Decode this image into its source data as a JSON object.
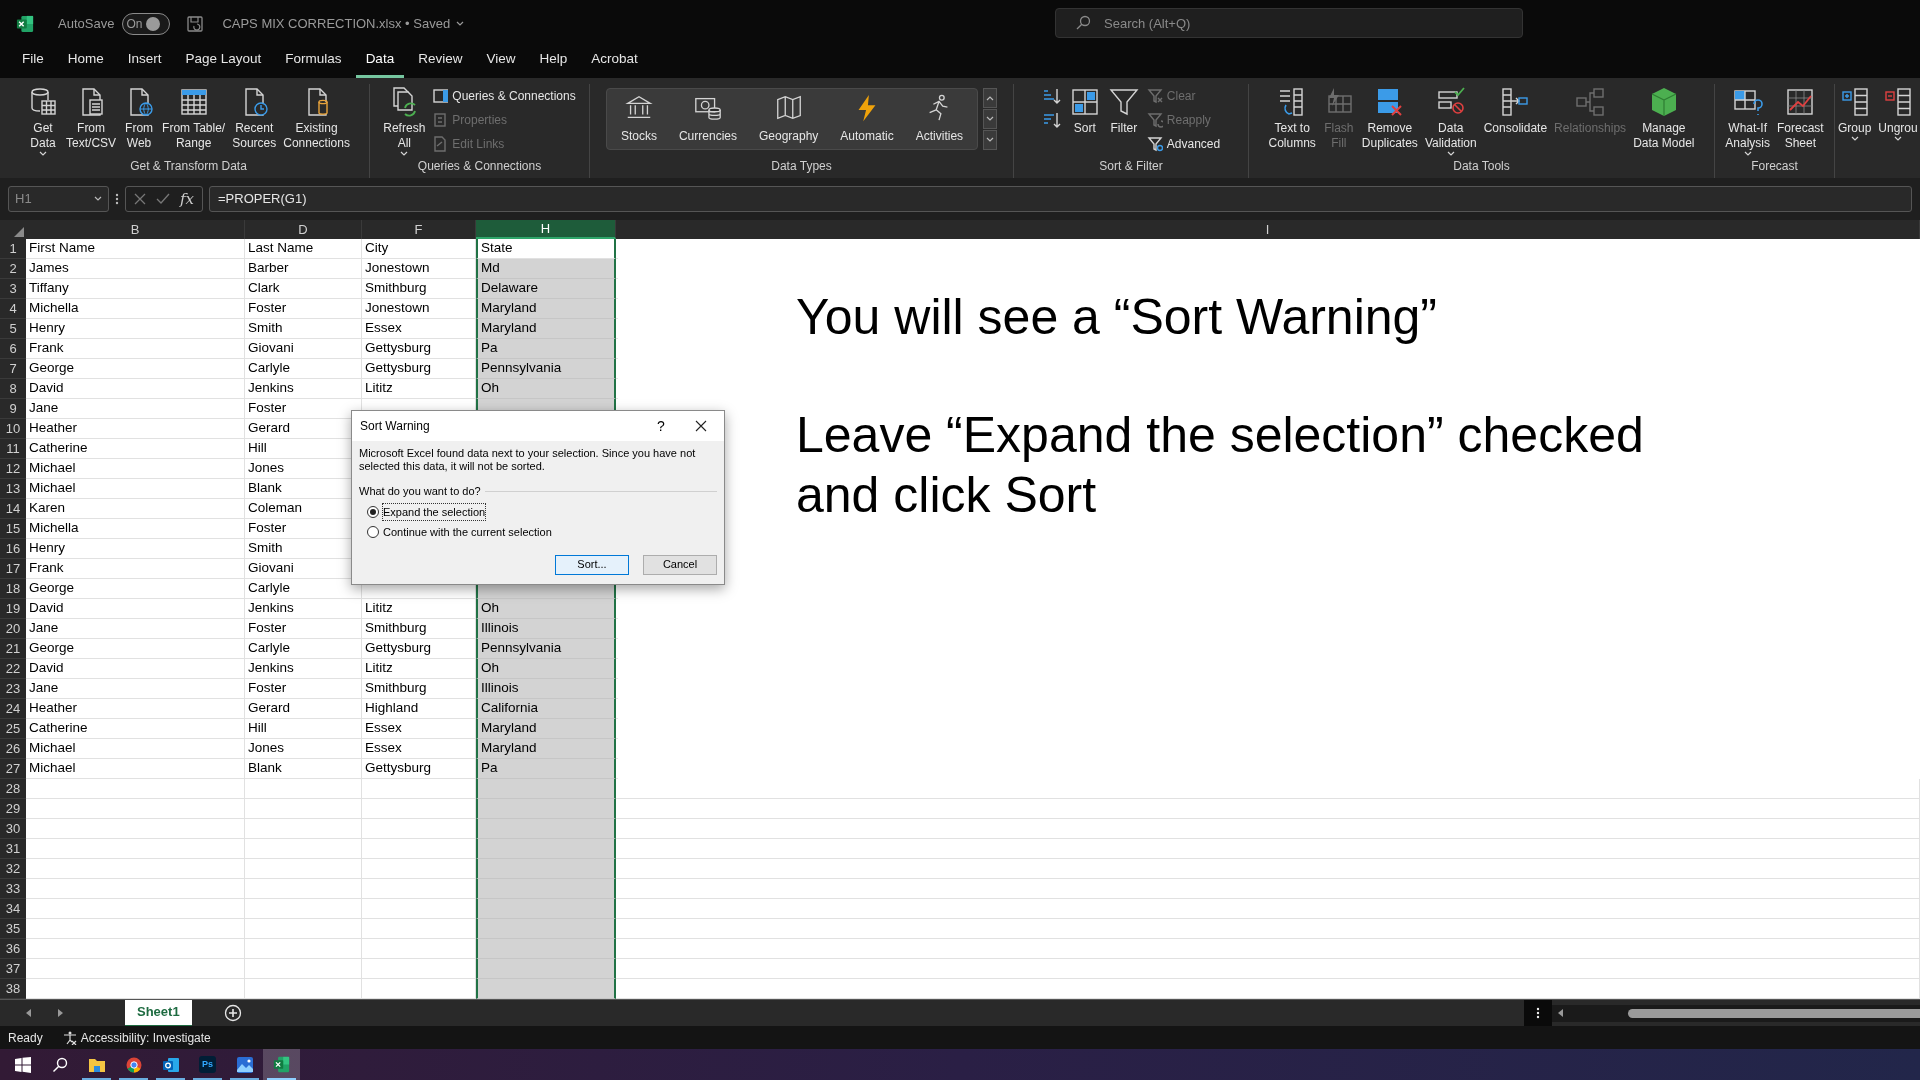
{
  "title_bar": {
    "autosave_label": "AutoSave",
    "autosave_on": true,
    "autosave_state": "On",
    "file_title": "CAPS MIX CORRECTION.xlsx • Saved",
    "search": {
      "placeholder": "Search (Alt+Q)"
    }
  },
  "menu_tabs": [
    {
      "label": "File",
      "selected": false
    },
    {
      "label": "Home",
      "selected": false
    },
    {
      "label": "Insert",
      "selected": false
    },
    {
      "label": "Page Layout",
      "selected": false
    },
    {
      "label": "Formulas",
      "selected": false
    },
    {
      "label": "Data",
      "selected": true
    },
    {
      "label": "Review",
      "selected": false
    },
    {
      "label": "View",
      "selected": false
    },
    {
      "label": "Help",
      "selected": false
    },
    {
      "label": "Acrobat",
      "selected": false
    }
  ],
  "ribbon_groups": [
    {
      "label": "Get & Transform Data",
      "items": [
        {
          "kind": "large",
          "label": "Get\nData",
          "dropdown": true,
          "disabled": false
        },
        {
          "kind": "large",
          "label": "From\nText/CSV",
          "disabled": false
        },
        {
          "kind": "large",
          "label": "From\nWeb",
          "disabled": false
        },
        {
          "kind": "large",
          "label": "From Table/\nRange",
          "disabled": false
        },
        {
          "kind": "large",
          "label": "Recent\nSources",
          "disabled": false
        },
        {
          "kind": "large",
          "label": "Existing\nConnections",
          "disabled": false
        }
      ]
    },
    {
      "label": "Queries & Connections",
      "items": [
        {
          "kind": "large",
          "label": "Refresh\nAll",
          "dropdown": true,
          "disabled": false
        },
        {
          "kind": "small",
          "label": "Queries & Connections",
          "disabled": false
        },
        {
          "kind": "small",
          "label": "Properties",
          "disabled": true
        },
        {
          "kind": "small",
          "label": "Edit Links",
          "disabled": true
        }
      ]
    },
    {
      "label": "Data Types",
      "items": [
        {
          "kind": "type",
          "label": "Stocks",
          "disabled": false
        },
        {
          "kind": "type",
          "label": "Currencies",
          "disabled": false
        },
        {
          "kind": "type",
          "label": "Geography",
          "disabled": false
        },
        {
          "kind": "type",
          "label": "Automatic",
          "disabled": false
        },
        {
          "kind": "type",
          "label": "Activities",
          "disabled": false
        }
      ]
    },
    {
      "label": "Sort & Filter",
      "items": [
        {
          "kind": "icon",
          "disabled": false
        },
        {
          "kind": "icon",
          "disabled": false
        },
        {
          "kind": "large",
          "label": "Sort",
          "disabled": false
        },
        {
          "kind": "large",
          "label": "Filter",
          "disabled": false
        },
        {
          "kind": "small",
          "label": "Clear",
          "disabled": true
        },
        {
          "kind": "small",
          "label": "Reapply",
          "disabled": true
        },
        {
          "kind": "small",
          "label": "Advanced",
          "disabled": false
        }
      ]
    },
    {
      "label": "Data Tools",
      "items": [
        {
          "kind": "large",
          "label": "Text to\nColumns",
          "disabled": false
        },
        {
          "kind": "large",
          "label": "Flash\nFill",
          "disabled": true
        },
        {
          "kind": "large",
          "label": "Remove\nDuplicates",
          "disabled": false
        },
        {
          "kind": "large",
          "label": "Data\nValidation",
          "dropdown": true,
          "disabled": false
        },
        {
          "kind": "large",
          "label": "Consolidate",
          "disabled": false
        },
        {
          "kind": "large",
          "label": "Relationships",
          "disabled": true
        },
        {
          "kind": "large",
          "label": "Manage\nData Model",
          "disabled": false
        }
      ]
    },
    {
      "label": "Forecast",
      "items": [
        {
          "kind": "large",
          "label": "What-If\nAnalysis",
          "dropdown": true,
          "disabled": false
        },
        {
          "kind": "large",
          "label": "Forecast\nSheet",
          "disabled": false
        }
      ]
    },
    {
      "items": [
        {
          "kind": "large",
          "label": "Group",
          "dropdown": true,
          "disabled": false
        },
        {
          "kind": "large",
          "label": "Ungrou",
          "dropdown": true,
          "disabled": false
        }
      ]
    }
  ],
  "formula_bar": {
    "name_box": "H1",
    "function_label": "fx",
    "formula": "=PROPER(G1)"
  },
  "columns": [
    {
      "label": "B",
      "selected": false
    },
    {
      "label": "D",
      "selected": false
    },
    {
      "label": "F",
      "selected": false
    },
    {
      "label": "H",
      "selected": true
    },
    {
      "label": "I",
      "selected": false
    }
  ],
  "rows": [
    {
      "number": "1",
      "cells": [
        "First Name",
        "Last Name",
        "City",
        "State"
      ]
    },
    {
      "number": "2",
      "cells": [
        "James",
        "Barber",
        "Jonestown",
        "Md"
      ]
    },
    {
      "number": "3",
      "cells": [
        "Tiffany",
        "Clark",
        "Smithburg",
        "Delaware"
      ]
    },
    {
      "number": "4",
      "cells": [
        "Michella",
        "Foster",
        "Jonestown",
        "Maryland"
      ]
    },
    {
      "number": "5",
      "cells": [
        "Henry",
        "Smith",
        "Essex",
        "Maryland"
      ]
    },
    {
      "number": "6",
      "cells": [
        "Frank",
        "Giovani",
        "Gettysburg",
        "Pa"
      ]
    },
    {
      "number": "7",
      "cells": [
        "George",
        "Carlyle",
        "Gettysburg",
        "Pennsylvania"
      ]
    },
    {
      "number": "8",
      "cells": [
        "David",
        "Jenkins",
        "Lititz",
        "Oh"
      ]
    },
    {
      "number": "9",
      "cells": [
        "Jane",
        "Foster"
      ]
    },
    {
      "number": "10",
      "cells": [
        "Heather",
        "Gerard"
      ]
    },
    {
      "number": "11",
      "cells": [
        "Catherine",
        "Hill"
      ]
    },
    {
      "number": "12",
      "cells": [
        "Michael",
        "Jones"
      ]
    },
    {
      "number": "13",
      "cells": [
        "Michael",
        "Blank"
      ]
    },
    {
      "number": "14",
      "cells": [
        "Karen",
        "Coleman"
      ]
    },
    {
      "number": "15",
      "cells": [
        "Michella",
        "Foster"
      ]
    },
    {
      "number": "16",
      "cells": [
        "Henry",
        "Smith"
      ]
    },
    {
      "number": "17",
      "cells": [
        "Frank",
        "Giovani"
      ]
    },
    {
      "number": "18",
      "cells": [
        "George",
        "Carlyle"
      ]
    },
    {
      "number": "19",
      "cells": [
        "David",
        "Jenkins",
        "Lititz",
        "Oh"
      ]
    },
    {
      "number": "20",
      "cells": [
        "Jane",
        "Foster",
        "Smithburg",
        "Illinois"
      ]
    },
    {
      "number": "21",
      "cells": [
        "George",
        "Carlyle",
        "Gettysburg",
        "Pennsylvania"
      ]
    },
    {
      "number": "22",
      "cells": [
        "David",
        "Jenkins",
        "Lititz",
        "Oh"
      ]
    },
    {
      "number": "23",
      "cells": [
        "Jane",
        "Foster",
        "Smithburg",
        "Illinois"
      ]
    },
    {
      "number": "24",
      "cells": [
        "Heather",
        "Gerard",
        "Highland",
        "California"
      ]
    },
    {
      "number": "25",
      "cells": [
        "Catherine",
        "Hill",
        "Essex",
        "Maryland"
      ]
    },
    {
      "number": "26",
      "cells": [
        "Michael",
        "Jones",
        "Essex",
        "Maryland"
      ]
    },
    {
      "number": "27",
      "cells": [
        "Michael",
        "Blank",
        "Gettysburg",
        "Pa"
      ]
    },
    {
      "number": "28"
    },
    {
      "number": "29"
    },
    {
      "number": "30"
    },
    {
      "number": "31"
    },
    {
      "number": "32"
    },
    {
      "number": "33"
    },
    {
      "number": "34"
    },
    {
      "number": "35"
    },
    {
      "number": "36"
    },
    {
      "number": "37"
    },
    {
      "number": "38"
    }
  ],
  "note": [
    "You will see a “Sort Warning”",
    "Leave “Expand the selection” checked\nand click Sort"
  ],
  "dialog": {
    "title": "Sort Warning",
    "help": "?",
    "message": "Microsoft Excel found data next to your selection.  Since you have not selected this data, it will not be sorted.",
    "question": "What do you want to do?",
    "options": [
      {
        "label": "Expand the selection",
        "selected": true
      },
      {
        "label": "Continue with the current selection",
        "selected": false
      }
    ],
    "buttons": [
      {
        "label": "Sort...",
        "default": true
      },
      {
        "label": "Cancel",
        "default": false
      }
    ]
  },
  "sheet_tabs": [
    {
      "label": "Sheet1",
      "selected": true
    }
  ],
  "status_bar": {
    "status": "Ready",
    "accessibility": "Accessibility: Investigate"
  },
  "taskbar": [
    {
      "kind": "windows",
      "running": false,
      "selected": false
    },
    {
      "kind": "search",
      "running": false,
      "selected": false
    },
    {
      "kind": "folder",
      "running": true,
      "selected": false
    },
    {
      "kind": "browser",
      "running": true,
      "selected": false
    },
    {
      "kind": "mail",
      "running": true,
      "selected": false
    },
    {
      "kind": "photoshop",
      "label": "Ps",
      "running": true,
      "selected": false
    },
    {
      "kind": "photos",
      "running": true,
      "selected": false
    },
    {
      "kind": "spreadsheet",
      "running": true,
      "selected": true
    }
  ]
}
